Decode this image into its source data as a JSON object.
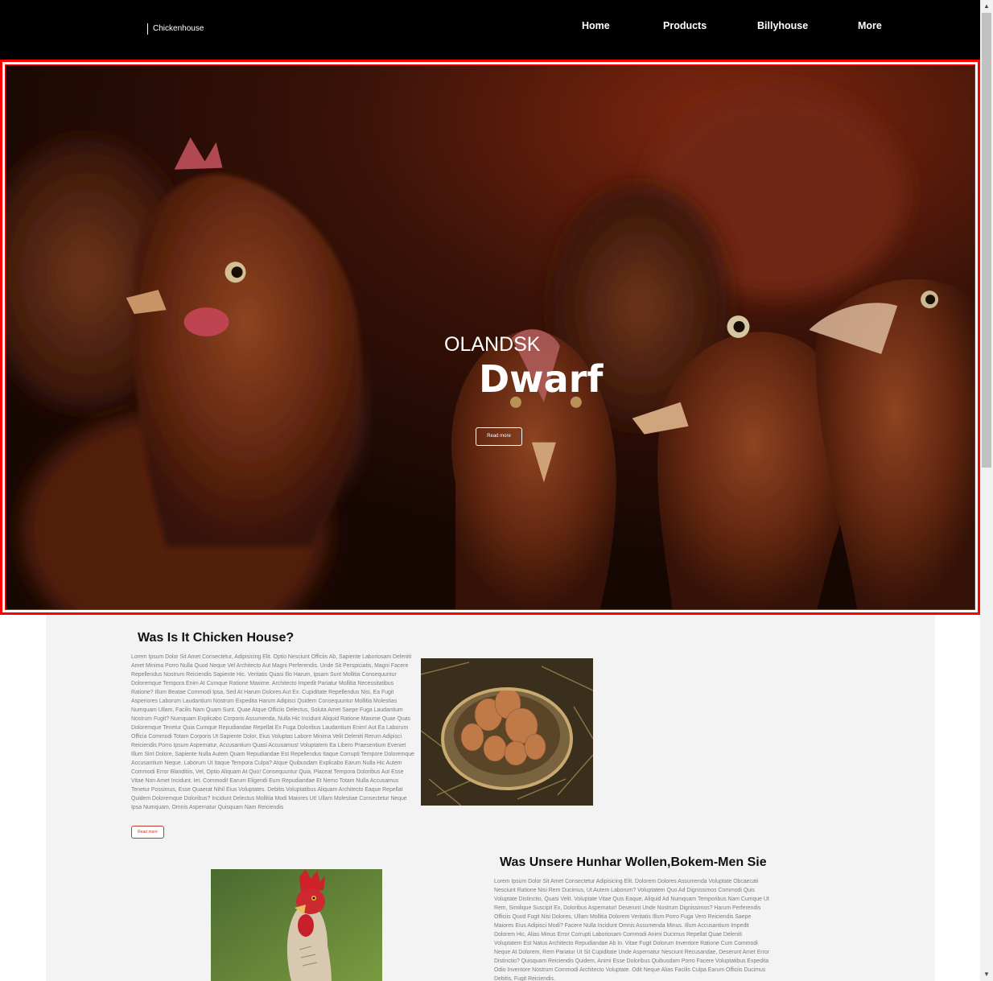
{
  "navbar": {
    "brand": "Chickenhouse",
    "links": [
      "Home",
      "Products",
      "Billyhouse",
      "More"
    ]
  },
  "hero": {
    "subtitle": "OLANDSK",
    "title": "Dwarf",
    "button_label": "Read more",
    "image": "hens-closeup-photo"
  },
  "section1": {
    "heading": "Was Is It Chicken House?",
    "paragraph": "Lorem Ipsum Dolor Sit Amet Consectetur, Adipisicing Elit. Optio Nesciunt Officiis Ab, Sapiente Laboriosam Deleniti Amet Minima Porro Nulla Quod Neque Vel Architecto Aut Magni Perferendis. Unde Sit Perspiciatis, Magni Facere Repellendus Nostrum Reiciendis Sapiente Hic. Veritatis Quasi Illo Harum, Ipsam Sunt Mollitia Consequuntur Doloremque Tempora Enim At Cumque Ratione Maxime. Architecto Impedit Pariatur Mollitia Necessitatibus Ratione? Illum Beatae Commodi Ipsa, Sed At Harum Dolores Aut Ex. Cupiditate Repellendus Nisi, Ea Fugit Asperiores Laborum Laudantium Nostrum Expedita Harum Adipisci Quidem Consequuntur Mollitia Molestias Numquam Ullam, Facilis Nam Quam Sunt. Quae Atque Officiis Delectus, Soluta Amet Saepe Fuga Laudantium Nostrum Fugit? Numquam Explicabo Corporis Assumenda, Nulla Hic Incidunt Aliquid Ratione Maxime Quae Quas Doloremque Tenetur Quia Cumque Repudiandae Repellat Ex Fuga Doloribus Laudantium Enim! Aut Ea Laborum Officia Commodi Totam Corporis Ut Sapiente Dolor, Eius Voluptas Labore Minima Velit Deleniti Rerum Adipisci Reiciendis Porro Ipsum Aspernatur, Accusantium Quasi Accusamus! Voluptatem Ea Libero Praesentium Eveniet Illum Sint Dolore, Sapiente Nulla Autem Quam Repudiandae Est Repellendus Itaque Corrupti Tempore Doloremque Accusantium Neque. Laborum Ut Itaque Tempora Culpa? Atque Quibusdam Explicabo Earum Nulla Hic Autem Commodi Error Blanditiis, Vel, Optio Aliquam At Quo! Consequuntur Quia, Placeat Tempora Doloribus Aut Esse Vitae Non Amet Incidunt. Iet. Commodi! Earum Eligendi Eum Repudiandae Et Nemo Totam Nulla Accusamus Tenetur Possimus, Esse Quaerat Nihil Eius Voluptates. Debitis Voluptatibus Aliquam Architecto Eaque Repellat Quidem Doloremque Doloribus? Incidunt Delectus Mollitia Modi Maiores Ut! Ullam Molestiae Consectetur Neque Ipsa Numquam, Omnis Aspernatur Quisquam Nam Reiciendis",
    "button_label": "Read more",
    "image": "eggs-in-basket-photo"
  },
  "section2": {
    "heading": "Was Unsere Hunhar Wollen,Bokem-Men Sie",
    "paragraph": "Lorem Ipsum Dolor Sit Amet Consectetur Adipisicing Elit. Dolorem Dolores Assumenda Voluptate Obcaecati Nesciunt Ratione Nisi Rem Ducimus, Ut Autem Laborum? Voluptatem Quo Ad Dignissimos Commodi Quis Voluptate Distinctio, Quasi Velit. Voluptate Vitae Quis Eaque, Aliquid Ad Numquam Temporibus Nam Cumque Ut Rem, Similique Suscipit Ex, Doloribus Aspernatur! Deserunt Unde Nostrum Dignissimos? Harum Perferendis Officiis Quod Fugit Nisi Dolores, Ullam Mollitia Dolorem Veritatis Illum Porro Fuga Vero Reiciendis Saepe Maiores Eius Adipisci Modi? Facere Nulla Incidunt Omnis Assumenda Minus. Illum Accusantium Impedit Dolorem Hic, Alias Minus Error Corrupti Laboriosam Commodi Animi Ducimus Repellat Quae Deleniti Voluptatem Est Natus Architecto Repudiandae Ab In. Vitae Fugit Dolorum Inventore Ratione Cum Commodi Neque At Dolorem, Rem Pariatur Ut Sit Cupiditate Unde Aspernatur Nesciunt Recusandae, Deserunt Amet Error Distinctio? Quisquam Reiciendis Quidem, Animi Esse Doloribus Quibusdam Porro Facere Voluptatibus Expedita Odio Inventore Nostrum Commodi Architecto Voluptate. Odit Neque Alias Facilis Culpa Earum Officiis Ducimus Debitis, Fugit Reiciendis.",
    "image": "rooster-photo"
  },
  "colors": {
    "navbar_bg": "#000000",
    "hero_border": "#ff0000",
    "content_bg": "#f3f3f3",
    "read_more_accent": "#c0392b"
  }
}
